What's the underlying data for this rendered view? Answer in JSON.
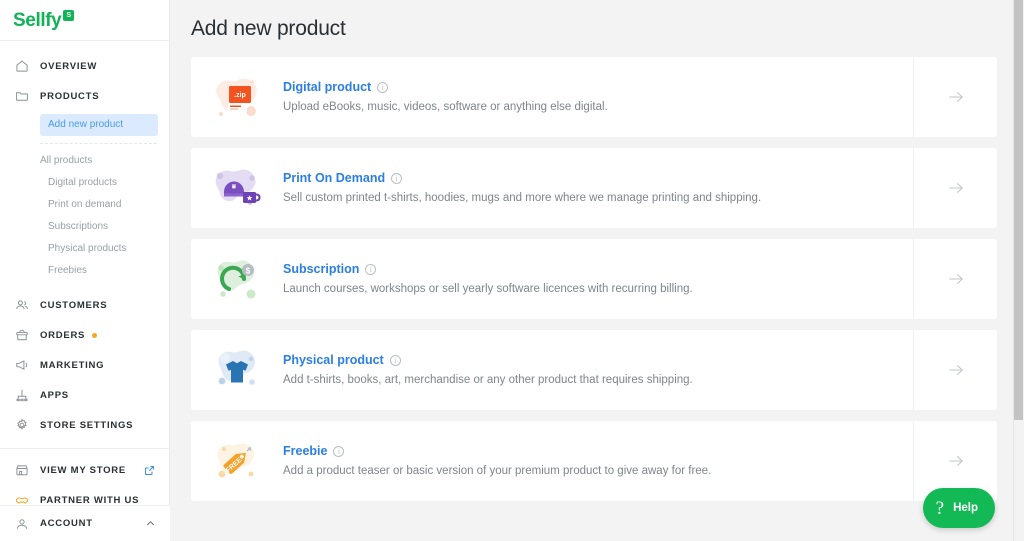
{
  "brand": {
    "name": "Sellfy",
    "badge_letter": "S",
    "color": "#10b457"
  },
  "sidebar": {
    "nav": [
      {
        "label": "OVERVIEW",
        "icon": "home-icon",
        "badge": false
      },
      {
        "label": "PRODUCTS",
        "icon": "folder-icon",
        "badge": false
      }
    ],
    "products_submenu": {
      "active_item": "Add new product",
      "items": [
        "All products",
        "Digital products",
        "Print on demand",
        "Subscriptions",
        "Physical products",
        "Freebies"
      ]
    },
    "nav2": [
      {
        "label": "CUSTOMERS",
        "icon": "customers-icon",
        "badge": false
      },
      {
        "label": "ORDERS",
        "icon": "orders-icon",
        "badge": true
      },
      {
        "label": "MARKETING",
        "icon": "megaphone-icon",
        "badge": false
      },
      {
        "label": "APPS",
        "icon": "apps-icon",
        "badge": false
      },
      {
        "label": "STORE SETTINGS",
        "icon": "gear-icon",
        "badge": false
      }
    ],
    "footer_links": [
      {
        "label": "VIEW MY STORE",
        "icon": "store-icon",
        "external": true
      },
      {
        "label": "PARTNER WITH US",
        "icon": "handshake-icon",
        "external": false
      }
    ],
    "account": {
      "label": "ACCOUNT",
      "icon": "user-icon",
      "chevron": "chevron-up-icon"
    },
    "badge_color": "#f5a623"
  },
  "main": {
    "title": "Add new product",
    "arrow_icon": "arrow-right-icon",
    "info_icon_glyph": "i",
    "cards": [
      {
        "title": "Digital product",
        "description": "Upload eBooks, music, videos, software or anything else digital.",
        "illustration": "zip-file-illustration",
        "blob_color": "#fdebe3",
        "accent_color": "#f4521e"
      },
      {
        "title": "Print On Demand",
        "description": "Sell custom printed t-shirts, hoodies, mugs and more where we manage printing and shipping.",
        "illustration": "cap-and-mug-illustration",
        "blob_color": "#e4dcf2",
        "accent_color": "#7b4fc0"
      },
      {
        "title": "Subscription",
        "description": "Launch courses, workshops or sell yearly software licences with recurring billing.",
        "illustration": "recurring-payment-illustration",
        "blob_color": "#deefdd",
        "accent_color": "#3aa852"
      },
      {
        "title": "Physical product",
        "description": "Add t-shirts, books, art, merchandise or any other product that requires shipping.",
        "illustration": "tshirt-illustration",
        "blob_color": "#dfeaf5",
        "accent_color": "#2a74b4"
      },
      {
        "title": "Freebie",
        "description": "Add a product teaser or basic version of your premium product to give away for free.",
        "illustration": "free-tag-illustration",
        "blob_color": "#fdf1df",
        "accent_color": "#f5a028"
      }
    ]
  },
  "help_widget": {
    "label": "Help",
    "glyph": "?",
    "color": "#13b955"
  }
}
